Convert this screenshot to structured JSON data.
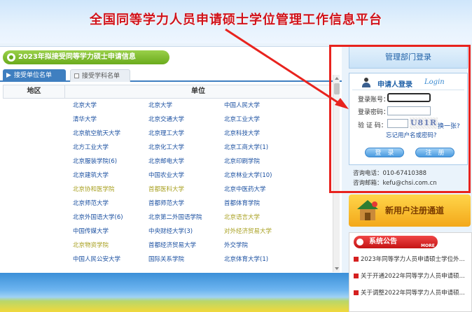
{
  "banner": {
    "title": "全国同等学力人员申请硕士学位管理工作信息平台"
  },
  "section": {
    "title": "2023年拟接受同等学力硕士申请信息"
  },
  "tabs": [
    {
      "label": "接受单位名单",
      "active": true
    },
    {
      "label": "接受学科名单",
      "active": false
    }
  ],
  "table": {
    "headers": {
      "area": "地区",
      "unit": "单位"
    },
    "rows": [
      [
        {
          "name": "北京大学",
          "color": "blue"
        },
        {
          "name": "北京大学",
          "color": "blue"
        },
        {
          "name": "中国人民大学",
          "color": "blue"
        }
      ],
      [
        {
          "name": "清华大学",
          "color": "blue"
        },
        {
          "name": "北京交通大学",
          "color": "blue"
        },
        {
          "name": "北京工业大学",
          "color": "blue"
        }
      ],
      [
        {
          "name": "北京航空航天大学",
          "color": "blue"
        },
        {
          "name": "北京理工大学",
          "color": "blue"
        },
        {
          "name": "北京科技大学",
          "color": "blue"
        }
      ],
      [
        {
          "name": "北方工业大学",
          "color": "blue"
        },
        {
          "name": "北京化工大学",
          "color": "blue"
        },
        {
          "name": "北京工商大学(1)",
          "color": "blue"
        }
      ],
      [
        {
          "name": "北京服装学院(6)",
          "color": "blue"
        },
        {
          "name": "北京邮电大学",
          "color": "blue"
        },
        {
          "name": "北京印刷学院",
          "color": "blue"
        }
      ],
      [
        {
          "name": "北京建筑大学",
          "color": "blue"
        },
        {
          "name": "中国农业大学",
          "color": "blue"
        },
        {
          "name": "北京林业大学(10)",
          "color": "blue"
        }
      ],
      [
        {
          "name": "北京协和医学院",
          "color": "olive"
        },
        {
          "name": "首都医科大学",
          "color": "olive"
        },
        {
          "name": "北京中医药大学",
          "color": "blue"
        }
      ],
      [
        {
          "name": "北京师范大学",
          "color": "blue"
        },
        {
          "name": "首都师范大学",
          "color": "blue"
        },
        {
          "name": "首都体育学院",
          "color": "blue"
        }
      ],
      [
        {
          "name": "北京外国语大学(6)",
          "color": "blue"
        },
        {
          "name": "北京第二外国语学院",
          "color": "blue"
        },
        {
          "name": "北京语言大学",
          "color": "olive"
        }
      ],
      [
        {
          "name": "中国传媒大学",
          "color": "blue"
        },
        {
          "name": "中央财经大学(3)",
          "color": "blue"
        },
        {
          "name": "对外经济贸易大学",
          "color": "olive"
        }
      ],
      [
        {
          "name": "北京物资学院",
          "color": "olive"
        },
        {
          "name": "首都经济贸易大学",
          "color": "blue"
        },
        {
          "name": "外交学院",
          "color": "blue"
        }
      ],
      [
        {
          "name": "中国人民公安大学",
          "color": "blue"
        },
        {
          "name": "国际关系学院",
          "color": "blue"
        },
        {
          "name": "北京体育大学(1)",
          "color": "blue"
        }
      ]
    ]
  },
  "admin": {
    "title": "管理部门登录"
  },
  "login": {
    "title": "申请人登录",
    "title_en": "Login",
    "account_label": "登录账号：",
    "password_label": "登录密码：",
    "captcha_label": "验 证 码：",
    "captcha_text": "U81R",
    "refresh_link": "换一张?",
    "forgot_link": "忘记用户名或密码?",
    "login_button": "登　录",
    "register_button": "注　册"
  },
  "contact": {
    "phone": "咨询电话：010-67410388",
    "email": "咨询邮箱：kefu@chsi.com.cn"
  },
  "register_channel": {
    "label": "新用户注册通道"
  },
  "notice": {
    "title": "系统公告",
    "more": "MORE",
    "items": [
      "2023年同等学力人员申请硕士学位外...",
      "关于开通2022年同等学力人员申请硕...",
      "关于调整2022年同等学力人员申请硕..."
    ]
  },
  "colors": {
    "title_red": "#d0121a",
    "link_blue": "#1a4fa0",
    "link_olive": "#a8a020",
    "section_green": "#6aab1c",
    "highlight_red": "#e8231e"
  }
}
